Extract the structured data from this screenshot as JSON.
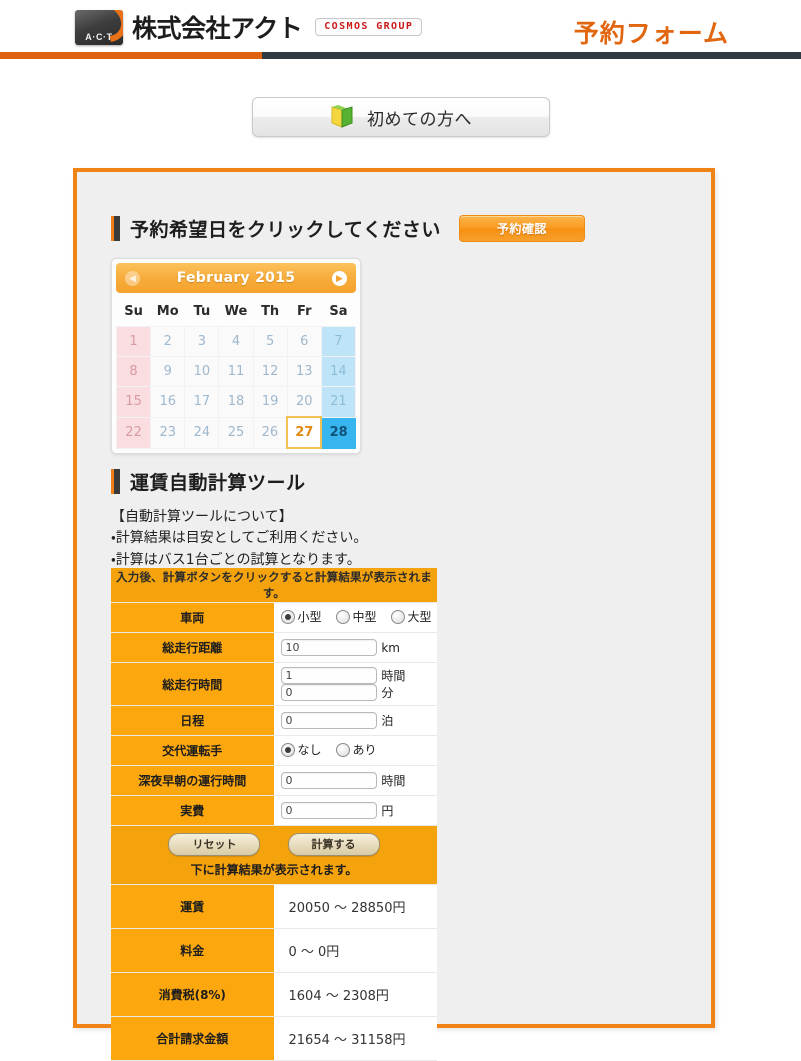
{
  "header": {
    "logo_badge_text": "A·C·T",
    "company_name": "株式会社アクト",
    "group_badge": "COSMOS GROUP",
    "page_title": "予約フォーム"
  },
  "firsttime": {
    "label": "初めての方へ",
    "icon": "open-book-icon"
  },
  "reservation": {
    "heading": "予約希望日をクリックしてください",
    "confirm_label": "予約確認"
  },
  "calendar": {
    "prev_icon": "◀",
    "next_icon": "▶",
    "title": "February 2015",
    "weekdays": [
      "Su",
      "Mo",
      "Tu",
      "We",
      "Th",
      "Fr",
      "Sa"
    ],
    "weeks": [
      [
        {
          "d": "1",
          "t": "sun"
        },
        {
          "d": "2",
          "t": ""
        },
        {
          "d": "3",
          "t": ""
        },
        {
          "d": "4",
          "t": ""
        },
        {
          "d": "5",
          "t": ""
        },
        {
          "d": "6",
          "t": ""
        },
        {
          "d": "7",
          "t": "sat"
        }
      ],
      [
        {
          "d": "8",
          "t": "sun"
        },
        {
          "d": "9",
          "t": ""
        },
        {
          "d": "10",
          "t": ""
        },
        {
          "d": "11",
          "t": ""
        },
        {
          "d": "12",
          "t": ""
        },
        {
          "d": "13",
          "t": ""
        },
        {
          "d": "14",
          "t": "sat"
        }
      ],
      [
        {
          "d": "15",
          "t": "sun"
        },
        {
          "d": "16",
          "t": ""
        },
        {
          "d": "17",
          "t": ""
        },
        {
          "d": "18",
          "t": ""
        },
        {
          "d": "19",
          "t": ""
        },
        {
          "d": "20",
          "t": ""
        },
        {
          "d": "21",
          "t": "sat"
        }
      ],
      [
        {
          "d": "22",
          "t": "sun"
        },
        {
          "d": "23",
          "t": ""
        },
        {
          "d": "24",
          "t": ""
        },
        {
          "d": "25",
          "t": ""
        },
        {
          "d": "26",
          "t": ""
        },
        {
          "d": "27",
          "t": "today"
        },
        {
          "d": "28",
          "t": "selected"
        }
      ]
    ],
    "selected_day": "28",
    "today_day": "27"
  },
  "tool": {
    "heading": "運賃自動計算ツール",
    "notes": [
      "【自動計算ツールについて】",
      "・計算結果は目安としてご利用ください。",
      "・計算はバス1台ごとの試算となります。"
    ],
    "banner": "入力後、計算ボタンをクリックすると計算結果が表示されます。",
    "rows": {
      "vehicle": {
        "label": "車両",
        "options": [
          {
            "label": "小型",
            "checked": true
          },
          {
            "label": "中型",
            "checked": false
          },
          {
            "label": "大型",
            "checked": false
          }
        ]
      },
      "distance": {
        "label": "総走行距離",
        "value": "10",
        "unit": "km"
      },
      "duration": {
        "label": "総走行時間",
        "hours": "1",
        "hour_unit": "時間",
        "minutes": "0",
        "minute_unit": "分"
      },
      "nights": {
        "label": "日程",
        "value": "0",
        "unit": "泊"
      },
      "relief_driver": {
        "label": "交代運転手",
        "options": [
          {
            "label": "なし",
            "checked": true
          },
          {
            "label": "あり",
            "checked": false
          }
        ]
      },
      "night_hours": {
        "label": "深夜早朝の運行時間",
        "value": "0",
        "unit": "時間"
      },
      "actual_cost": {
        "label": "実費",
        "value": "0",
        "unit": "円"
      }
    },
    "buttons": {
      "reset": "リセット",
      "calculate": "計算する",
      "note": "下に計算結果が表示されます。"
    },
    "results": [
      {
        "label": "運賃",
        "value": "20050 〜 28850円"
      },
      {
        "label": "料金",
        "value": "0 〜 0円"
      },
      {
        "label": "消費税(8%)",
        "value": "1604 〜 2308円"
      },
      {
        "label": "合計請求金額",
        "value": "21654 〜 31158円"
      }
    ]
  },
  "colors": {
    "brand_orange": "#ef8316",
    "header_orange": "#e2650f",
    "table_orange": "#fba70d",
    "header_dark": "#323a42",
    "selected_blue": "#36b5ef",
    "sunday_pink": "#fadde0",
    "saturday_blue": "#bfe4f7"
  }
}
